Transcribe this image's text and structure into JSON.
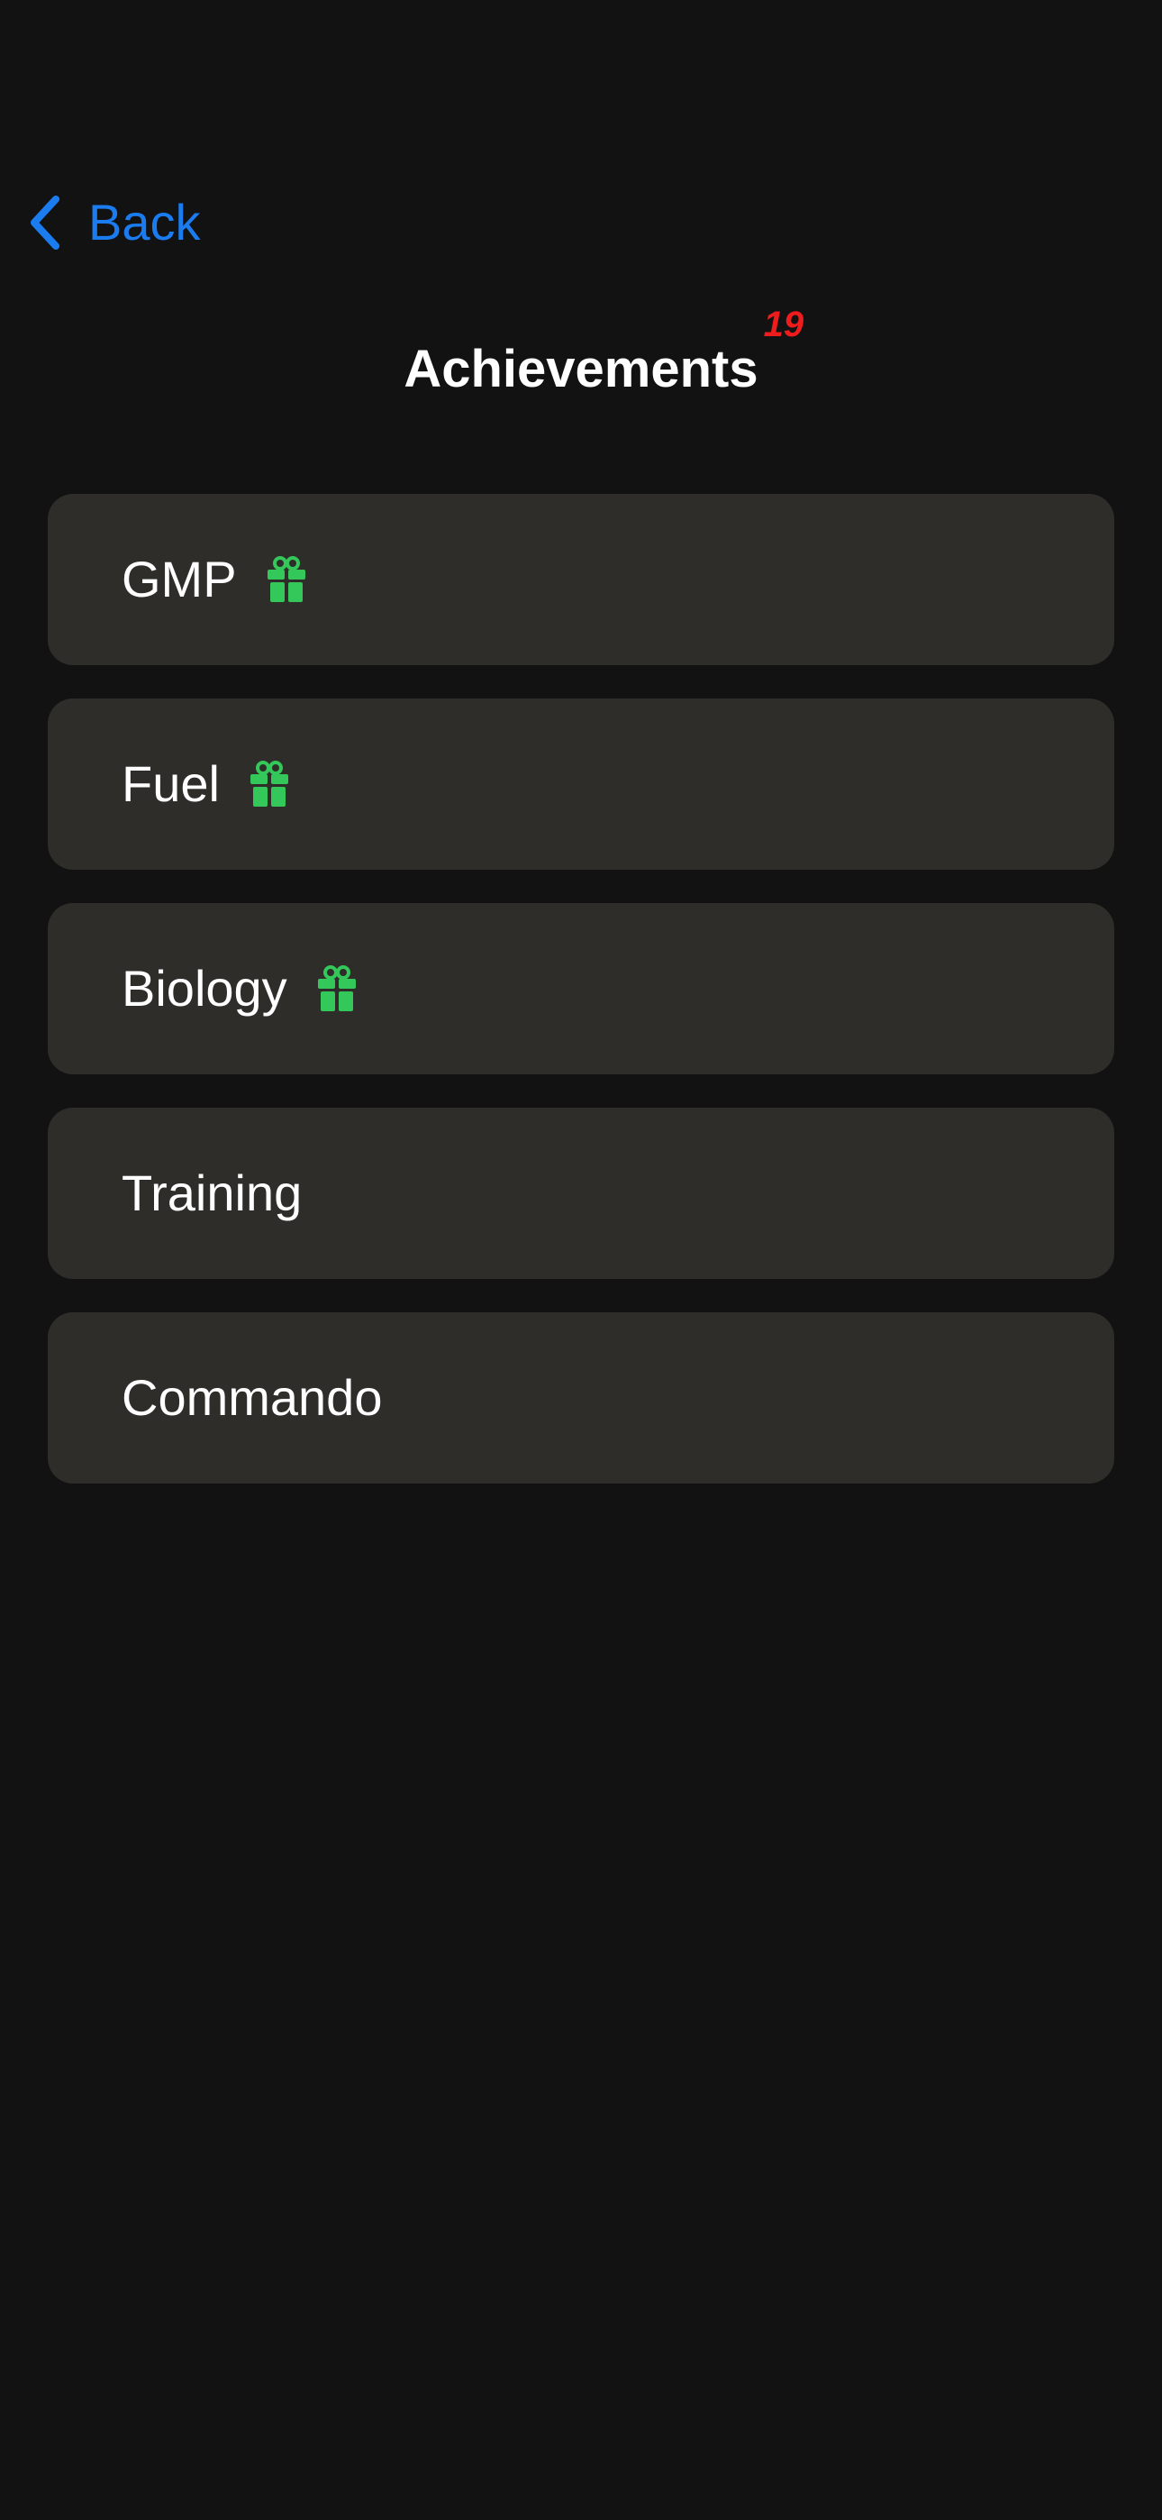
{
  "nav": {
    "back_label": "Back",
    "back_icon": "chevron-left-icon",
    "accent_color": "#1b7cf0"
  },
  "header": {
    "title": "Achievements",
    "badge_count": "19",
    "badge_color": "#ee1c1c"
  },
  "categories": [
    {
      "label": "GMP",
      "has_reward": true,
      "icon": "gift-icon"
    },
    {
      "label": "Fuel",
      "has_reward": true,
      "icon": "gift-icon"
    },
    {
      "label": "Biology",
      "has_reward": true,
      "icon": "gift-icon"
    },
    {
      "label": "Training",
      "has_reward": false
    },
    {
      "label": "Commando",
      "has_reward": false
    }
  ],
  "colors": {
    "background": "#121212",
    "card": "#2e2d29",
    "reward_icon": "#34c759"
  }
}
